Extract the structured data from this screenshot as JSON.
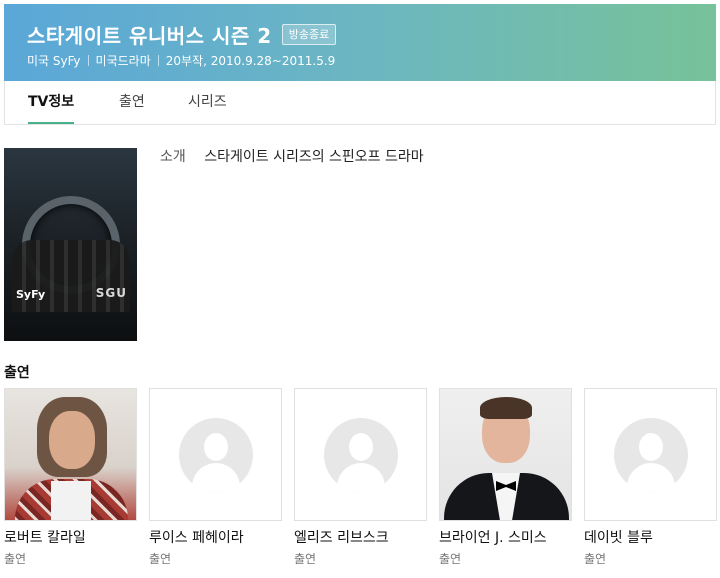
{
  "header": {
    "title": "스타게이트 유니버스 시즌 2",
    "badge": "방송종료",
    "meta": [
      "미국 SyFy",
      "미국드라마",
      "20부작, 2010.9.28~2011.5.9"
    ]
  },
  "tabs": [
    {
      "label": "TV정보",
      "active": true
    },
    {
      "label": "출연",
      "active": false
    },
    {
      "label": "시리즈",
      "active": false
    }
  ],
  "poster": {
    "logo_left": "SyFy",
    "logo_right": "SGU"
  },
  "intro": {
    "label": "소개",
    "text": "스타게이트 시리즈의 스핀오프 드라마"
  },
  "cast": {
    "heading": "출연",
    "members": [
      {
        "name": "로버트 칼라일",
        "role": "출연",
        "photo": "photo"
      },
      {
        "name": "루이스 페헤이라",
        "role": "출연",
        "photo": "placeholder-icon"
      },
      {
        "name": "엘리즈 리브스크",
        "role": "출연",
        "photo": "placeholder-icon"
      },
      {
        "name": "브라이언 J. 스미스",
        "role": "출연",
        "photo": "photo"
      },
      {
        "name": "데이빗 블루",
        "role": "출연",
        "photo": "placeholder-icon"
      }
    ]
  },
  "colors": {
    "accent": "#47b28a",
    "header_start": "#5aa7d8",
    "header_end": "#77c299"
  }
}
